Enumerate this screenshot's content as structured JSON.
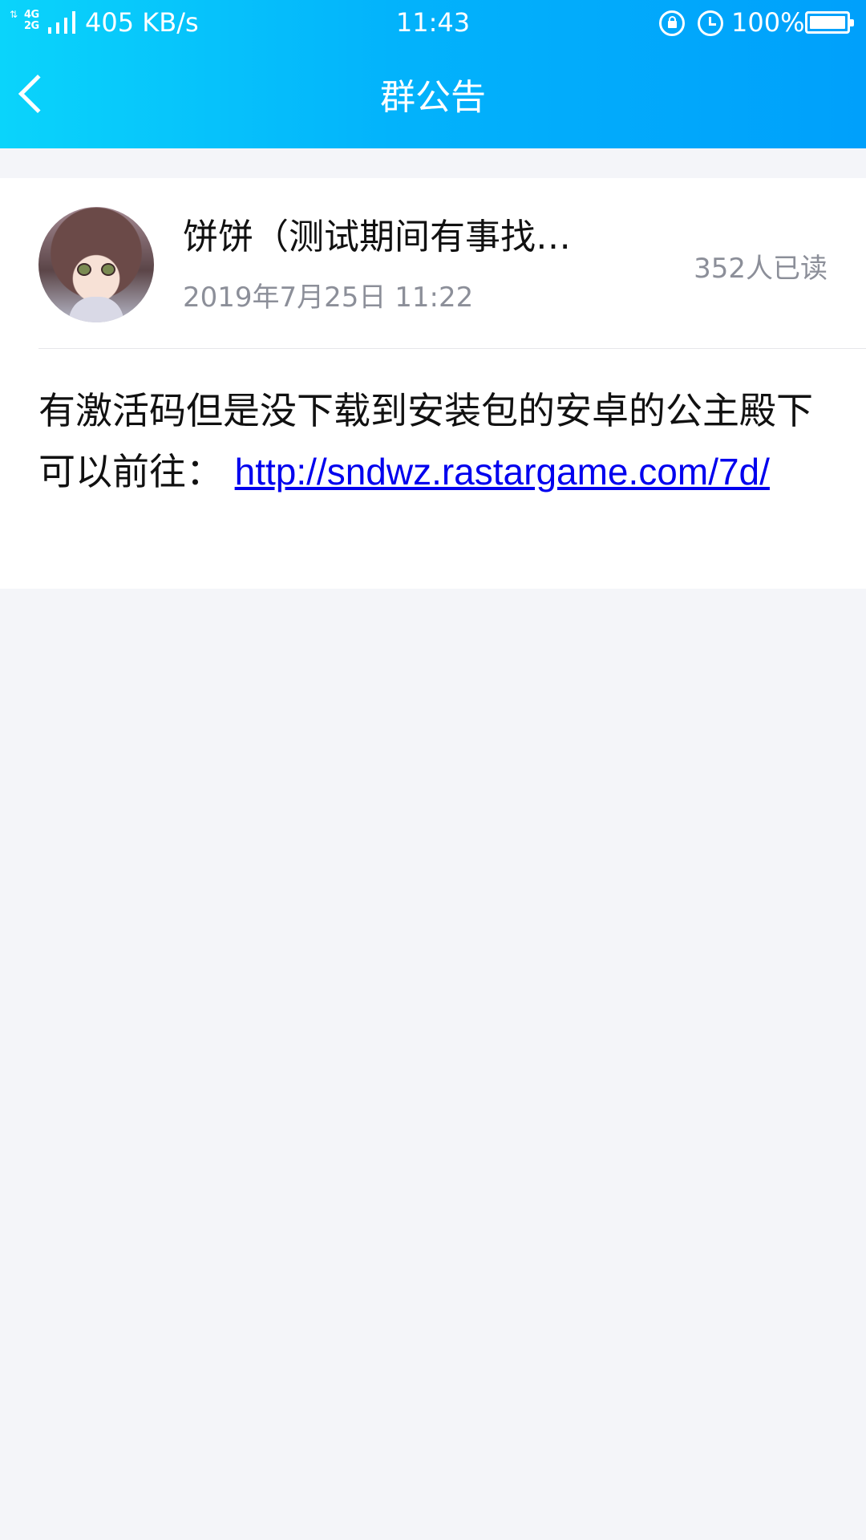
{
  "status_bar": {
    "network_type_top": "4G",
    "network_type_bottom": "2G",
    "net_speed": "405 KB/s",
    "time": "11:43",
    "battery_percent": "100%",
    "battery_level": 1.0,
    "icons": [
      "signal-icon",
      "rotation-lock-icon",
      "alarm-icon",
      "battery-icon"
    ]
  },
  "header": {
    "title": "群公告",
    "back_icon": "chevron-left-icon",
    "gradient_colors": [
      "#0ad4fb",
      "#00a0fb"
    ]
  },
  "announcement": {
    "author_name": "饼饼（测试期间有事找…",
    "date": "2019年7月25日 11:22",
    "read_count": "352人已读",
    "body_text": "有激活码但是没下载到安装包的安卓的公主殿下可以前往：",
    "link_text": "http://sndwz.rastargame.com/7d/"
  },
  "colors": {
    "background": "#f4f5f9",
    "secondary_text": "#8c8f99",
    "link": "#0000ee"
  }
}
